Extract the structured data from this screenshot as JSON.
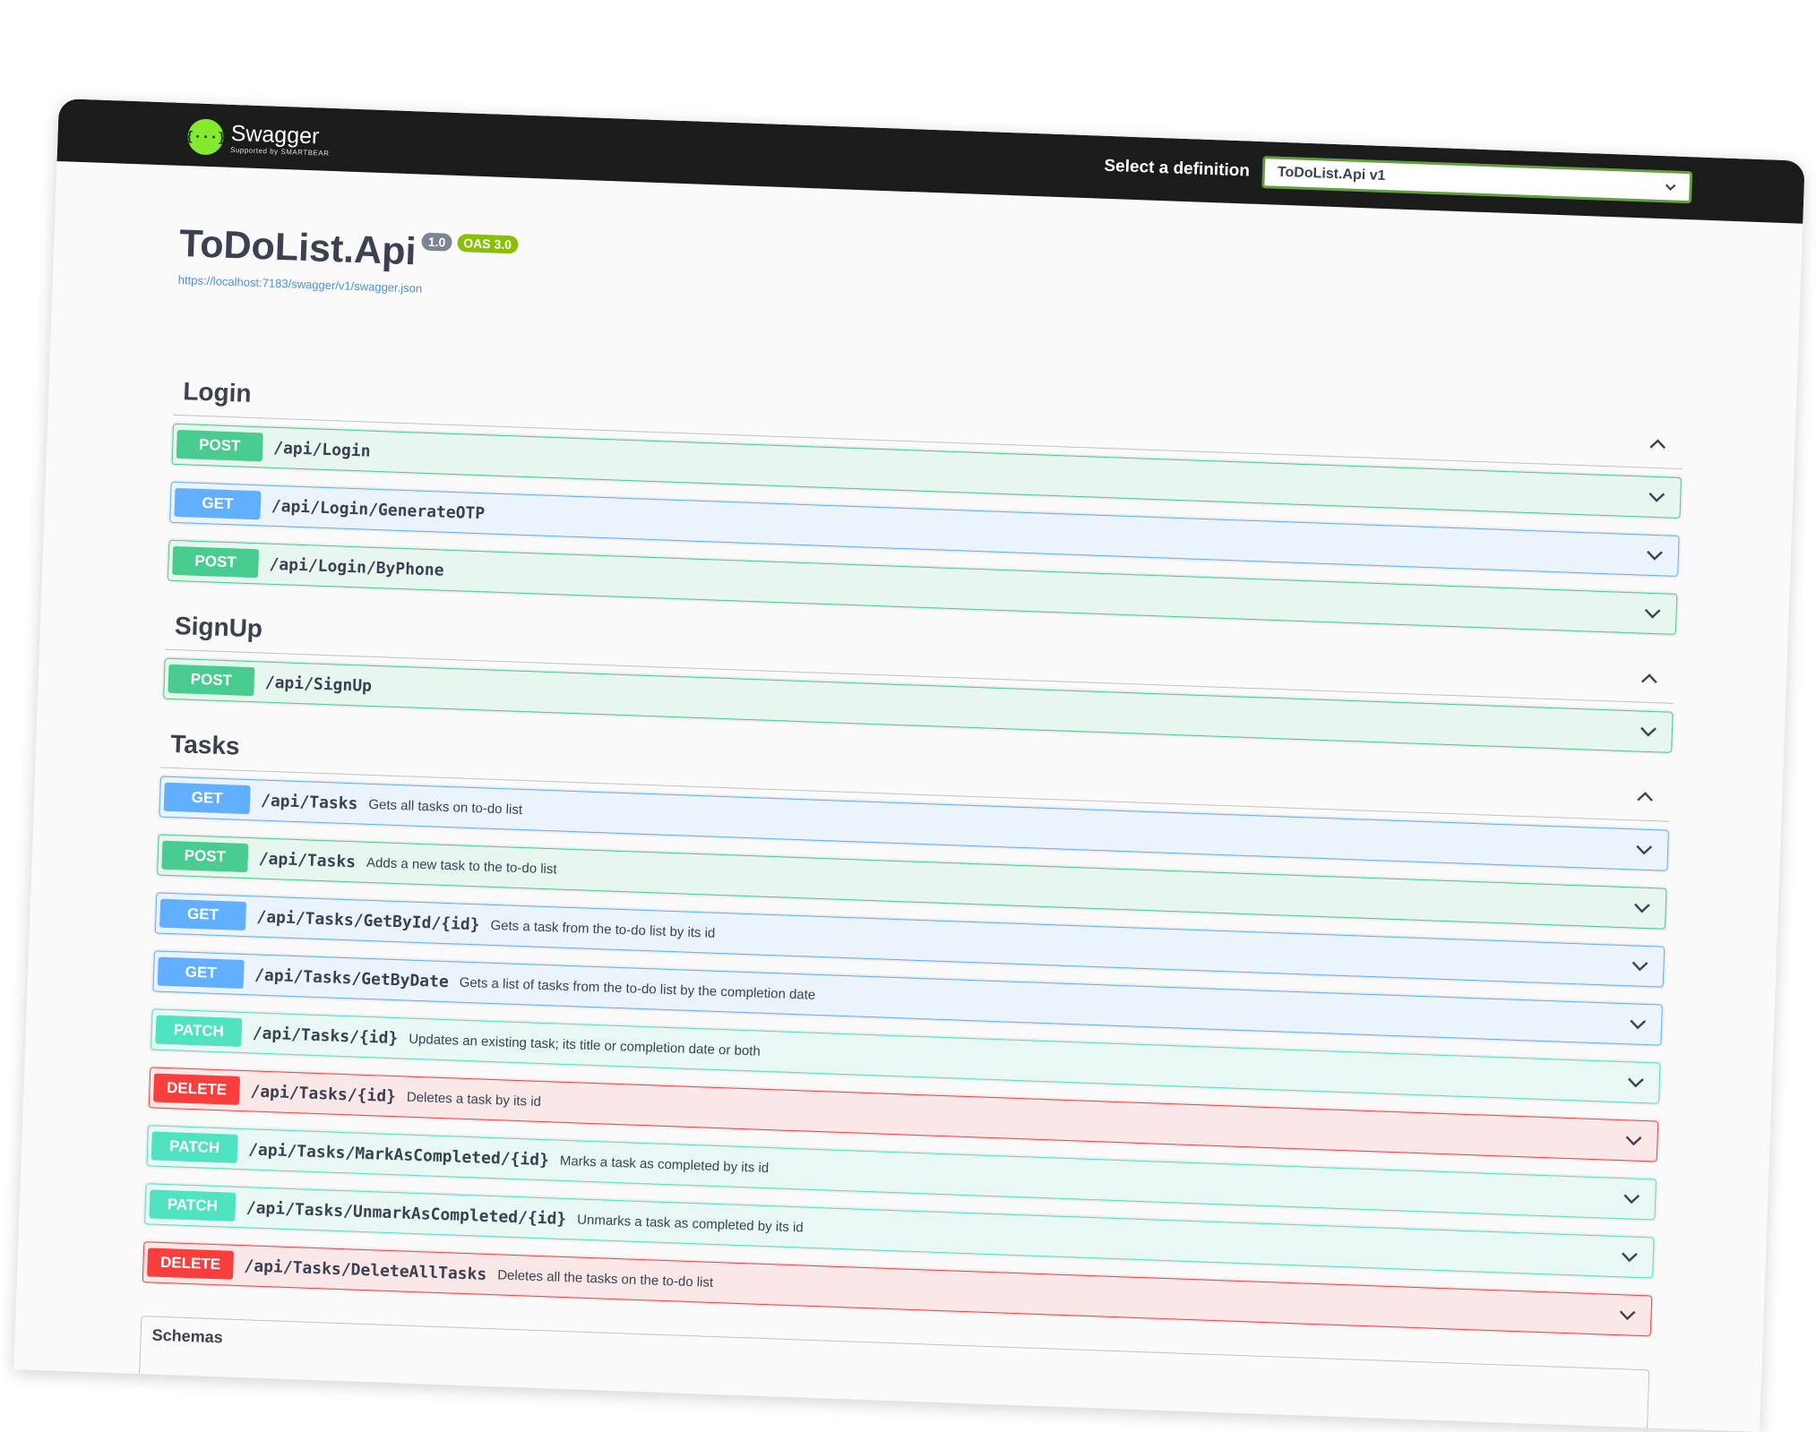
{
  "topbar": {
    "logo_name": "Swagger",
    "logo_sub": "Supported by SMARTBEAR",
    "definition_label": "Select a definition",
    "definition_value": "ToDoList.Api v1"
  },
  "info": {
    "title": "ToDoList.Api",
    "version": "1.0",
    "oas": "OAS 3.0",
    "spec_url": "https://localhost:7183/swagger/v1/swagger.json"
  },
  "tags": [
    {
      "name": "Login",
      "operations": [
        {
          "method": "POST",
          "path": "/api/Login",
          "summary": ""
        },
        {
          "method": "GET",
          "path": "/api/Login/GenerateOTP",
          "summary": ""
        },
        {
          "method": "POST",
          "path": "/api/Login/ByPhone",
          "summary": ""
        }
      ]
    },
    {
      "name": "SignUp",
      "operations": [
        {
          "method": "POST",
          "path": "/api/SignUp",
          "summary": ""
        }
      ]
    },
    {
      "name": "Tasks",
      "operations": [
        {
          "method": "GET",
          "path": "/api/Tasks",
          "summary": "Gets all tasks on to-do list"
        },
        {
          "method": "POST",
          "path": "/api/Tasks",
          "summary": "Adds a new task to the to-do list"
        },
        {
          "method": "GET",
          "path": "/api/Tasks/GetById/{id}",
          "summary": "Gets a task from the to-do list by its id"
        },
        {
          "method": "GET",
          "path": "/api/Tasks/GetByDate",
          "summary": "Gets a list of tasks from the to-do list by the completion date"
        },
        {
          "method": "PATCH",
          "path": "/api/Tasks/{id}",
          "summary": "Updates an existing task; its title or completion date or both"
        },
        {
          "method": "DELETE",
          "path": "/api/Tasks/{id}",
          "summary": "Deletes a task by its id"
        },
        {
          "method": "PATCH",
          "path": "/api/Tasks/MarkAsCompleted/{id}",
          "summary": "Marks a task as completed by its id"
        },
        {
          "method": "PATCH",
          "path": "/api/Tasks/UnmarkAsCompleted/{id}",
          "summary": "Unmarks a task as completed by its id"
        },
        {
          "method": "DELETE",
          "path": "/api/Tasks/DeleteAllTasks",
          "summary": "Deletes all the tasks on the to-do list"
        }
      ]
    }
  ],
  "schemas": {
    "title": "Schemas"
  },
  "icons": {
    "tag_toggle": "chevron-up-icon",
    "op_toggle": "chevron-down-icon",
    "select_arrow": "chevron-down-icon"
  },
  "colors": {
    "get": "#61affe",
    "post": "#49cc90",
    "patch": "#50e3c2",
    "delete": "#f93e3e",
    "topbar": "#1b1b1b",
    "accent": "#85ea2d"
  }
}
